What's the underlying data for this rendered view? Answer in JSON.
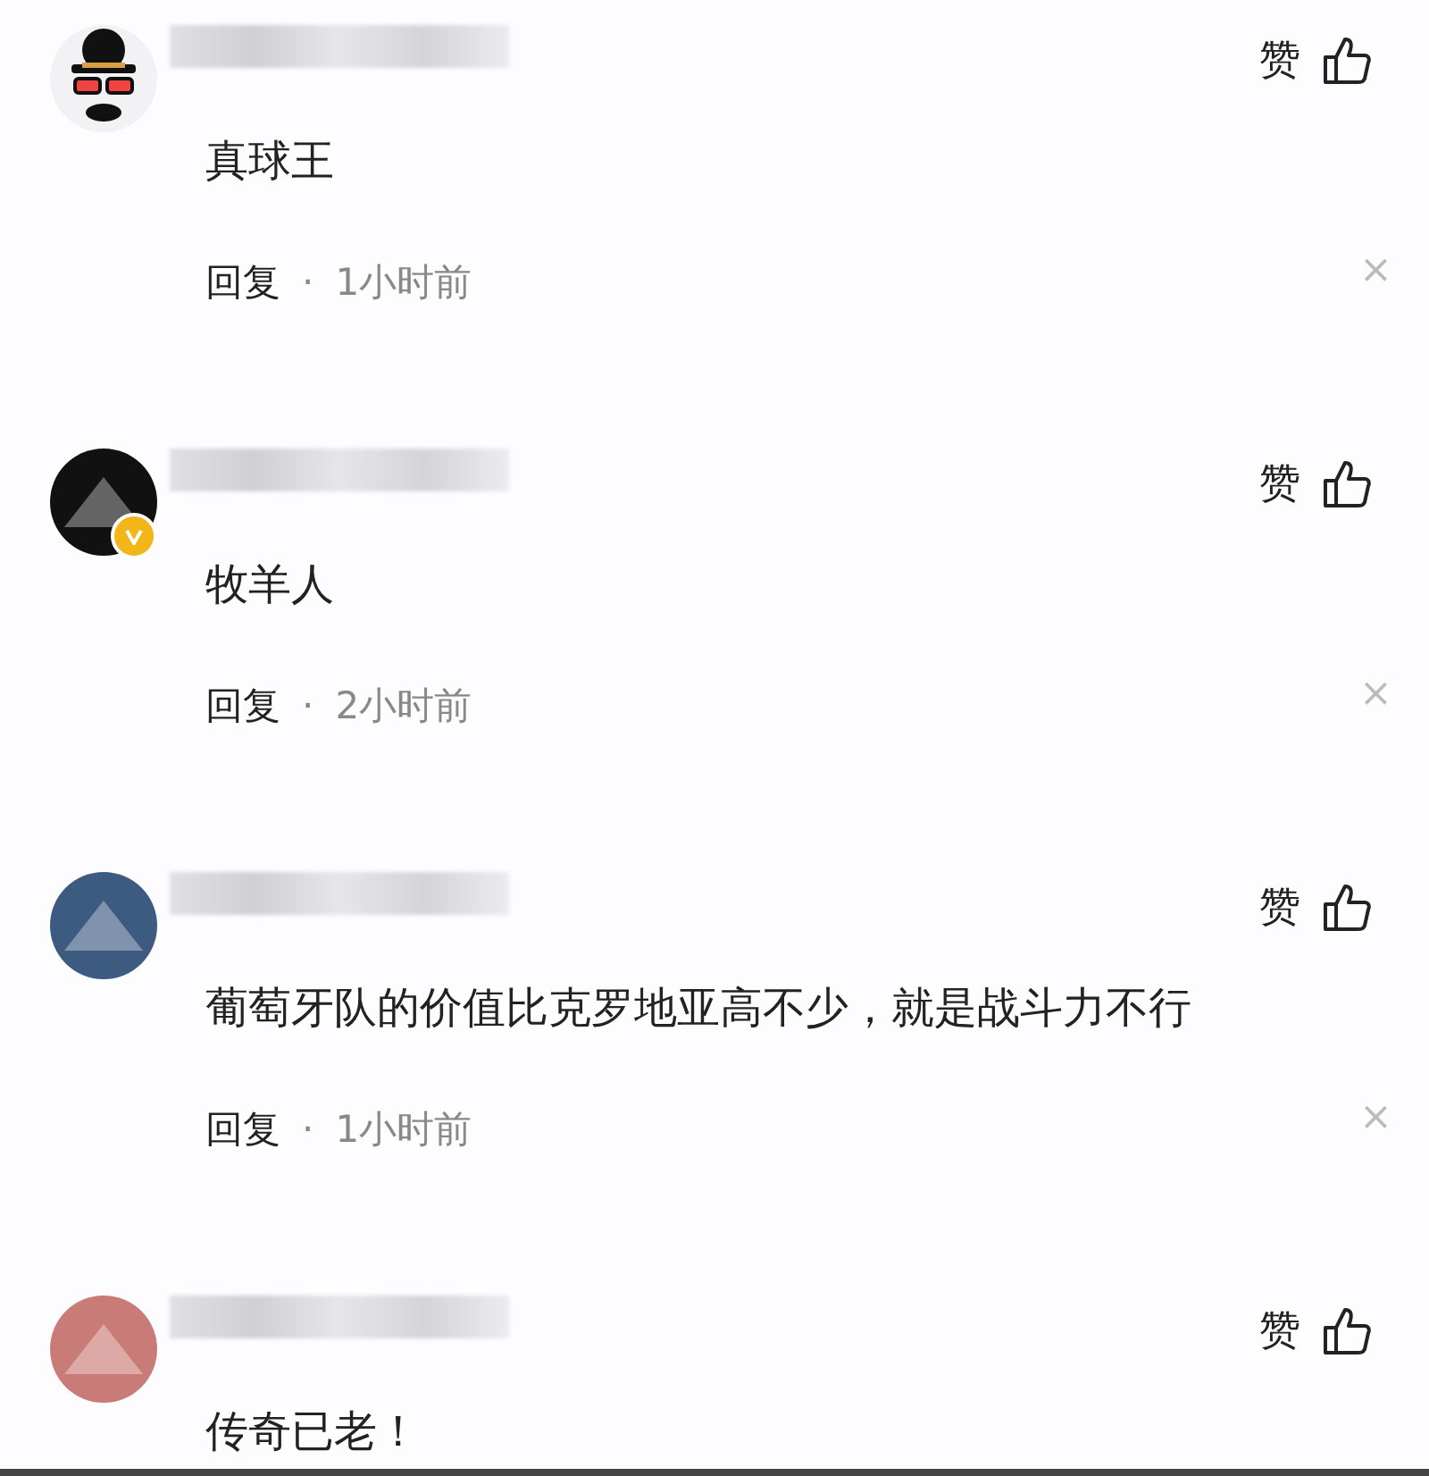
{
  "comments": [
    {
      "avatar": {
        "color": "#f2f2f5",
        "kind": "hat"
      },
      "verified": false,
      "text": "真球王",
      "like_label": "赞",
      "reply_label": "回复",
      "separator": "·",
      "time": "1小时前",
      "dismiss": "×"
    },
    {
      "avatar": {
        "color": "#111111",
        "kind": "plain"
      },
      "verified": true,
      "text": "牧羊人",
      "like_label": "赞",
      "reply_label": "回复",
      "separator": "·",
      "time": "2小时前",
      "dismiss": "×"
    },
    {
      "avatar": {
        "color": "#3d5a80",
        "kind": "plain"
      },
      "verified": false,
      "text": "葡萄牙队的价值比克罗地亚高不少，就是战斗力不行",
      "like_label": "赞",
      "reply_label": "回复",
      "separator": "·",
      "time": "1小时前",
      "dismiss": "×"
    },
    {
      "avatar": {
        "color": "#c97b78",
        "kind": "plain"
      },
      "verified": false,
      "text": "传奇已老！",
      "like_label": "赞"
    }
  ]
}
